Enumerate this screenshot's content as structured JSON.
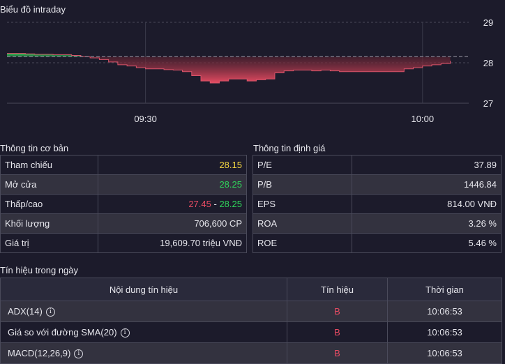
{
  "chart": {
    "title": "Biểu đồ intraday",
    "reference": 28.15,
    "ylim": [
      27,
      29
    ],
    "y_ticks": [
      "29",
      "28",
      "27"
    ],
    "x_ticks": [
      "09:30",
      "10:00"
    ]
  },
  "chart_data": {
    "type": "area",
    "title": "Biểu đồ intraday",
    "xlabel": "",
    "ylabel": "",
    "ylim": [
      27,
      29
    ],
    "xlim": [
      "09:15",
      "10:05"
    ],
    "reference": 28.15,
    "colors": {
      "above": "#2fd35a",
      "below": "#e64b62",
      "reference_line": "#9a9aa6"
    },
    "series": [
      {
        "x": [
          "09:15",
          "09:16",
          "09:17",
          "09:18",
          "09:19",
          "09:20",
          "09:21",
          "09:22",
          "09:23",
          "09:24",
          "09:25",
          "09:26",
          "09:27",
          "09:28",
          "09:29",
          "09:30",
          "09:31",
          "09:32",
          "09:33",
          "09:34",
          "09:35",
          "09:36",
          "09:37",
          "09:38",
          "09:39",
          "09:40",
          "09:41",
          "09:42",
          "09:43",
          "09:44",
          "09:45",
          "09:46",
          "09:47",
          "09:48",
          "09:49",
          "09:50",
          "09:51",
          "09:52",
          "09:53",
          "09:54",
          "09:55",
          "09:56",
          "09:57",
          "09:58",
          "09:59",
          "10:00",
          "10:01",
          "10:02",
          "10:03"
        ],
        "y": [
          28.23,
          28.23,
          28.22,
          28.21,
          28.21,
          28.2,
          28.2,
          28.18,
          28.15,
          28.12,
          28.08,
          28.02,
          27.95,
          27.92,
          27.88,
          27.85,
          27.85,
          27.83,
          27.82,
          27.78,
          27.68,
          27.55,
          27.5,
          27.55,
          27.6,
          27.6,
          27.55,
          27.58,
          27.6,
          27.75,
          27.8,
          27.82,
          27.82,
          27.8,
          27.82,
          27.8,
          27.78,
          27.78,
          27.78,
          27.78,
          27.78,
          27.78,
          27.78,
          27.85,
          27.88,
          27.92,
          27.95,
          27.98,
          28.05
        ]
      }
    ],
    "grid": true
  },
  "basic": {
    "title": "Thông tin cơ bản",
    "ref_label": "Tham chiếu",
    "ref_value": "28.15",
    "open_label": "Mở cửa",
    "open_value": "28.25",
    "range_label": "Thấp/cao",
    "low": "27.45",
    "sep": "-",
    "high": "28.25",
    "volume_label": "Khối lượng",
    "volume_value": "706,600 CP",
    "value_label": "Giá trị",
    "value_value": "19,609.70 triệu VNĐ"
  },
  "valuation": {
    "title": "Thông tin định giá",
    "rows": [
      {
        "label": "P/E",
        "value": "37.89"
      },
      {
        "label": "P/B",
        "value": "1446.84"
      },
      {
        "label": "EPS",
        "value": "814.00 VNĐ"
      },
      {
        "label": "ROA",
        "value": "3.26 %"
      },
      {
        "label": "ROE",
        "value": "5.46 %"
      }
    ]
  },
  "signals": {
    "title": "Tín hiệu trong ngày",
    "headers": [
      "Nội dung tín hiệu",
      "Tín hiệu",
      "Thời gian"
    ],
    "rows": [
      {
        "name": "ADX(14)",
        "signal": "B",
        "time": "10:06:53"
      },
      {
        "name": "Giá so với đường SMA(20)",
        "signal": "B",
        "time": "10:06:53"
      },
      {
        "name": "MACD(12,26,9)",
        "signal": "B",
        "time": "10:06:53"
      }
    ],
    "info_icon": "i"
  }
}
